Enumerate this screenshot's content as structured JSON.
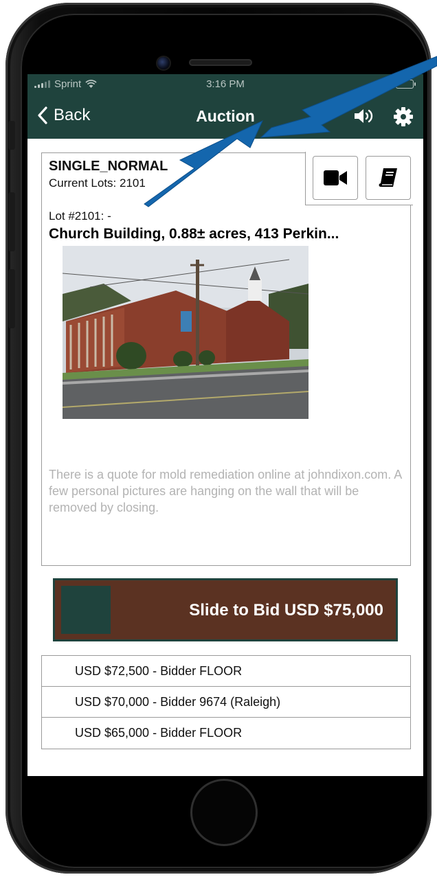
{
  "status_bar": {
    "carrier": "Sprint",
    "time": "3:16 PM"
  },
  "nav": {
    "back_label": "Back",
    "title": "Auction"
  },
  "lot": {
    "auction_name": "SINGLE_NORMAL",
    "current_lots": "Current Lots: 2101",
    "lot_number": "Lot #2101: -",
    "title": "Church Building, 0.88± acres, 413 Perkin...",
    "description": "There is a quote for mold remediation online at johndixon.com.  A few personal pictures are hanging on the wall that will be removed by closing."
  },
  "icons": {
    "back": "chevron-left-icon",
    "sound": "speaker-icon",
    "settings": "gear-icon",
    "video": "video-camera-icon",
    "catalog": "book-icon"
  },
  "bid_slider": {
    "label": "Slide to Bid USD $75,000"
  },
  "bid_history": [
    {
      "text": "USD $72,500 - Bidder FLOOR"
    },
    {
      "text": "USD $70,000 - Bidder 9674 (Raleigh)"
    },
    {
      "text": "USD $65,000 - Bidder FLOOR"
    }
  ],
  "colors": {
    "header": "#1f433d",
    "slider_background": "#5b3222",
    "slider_thumb": "#1f433d",
    "annotation_arrow": "#1466ad",
    "description_text": "#b3b3b3"
  }
}
